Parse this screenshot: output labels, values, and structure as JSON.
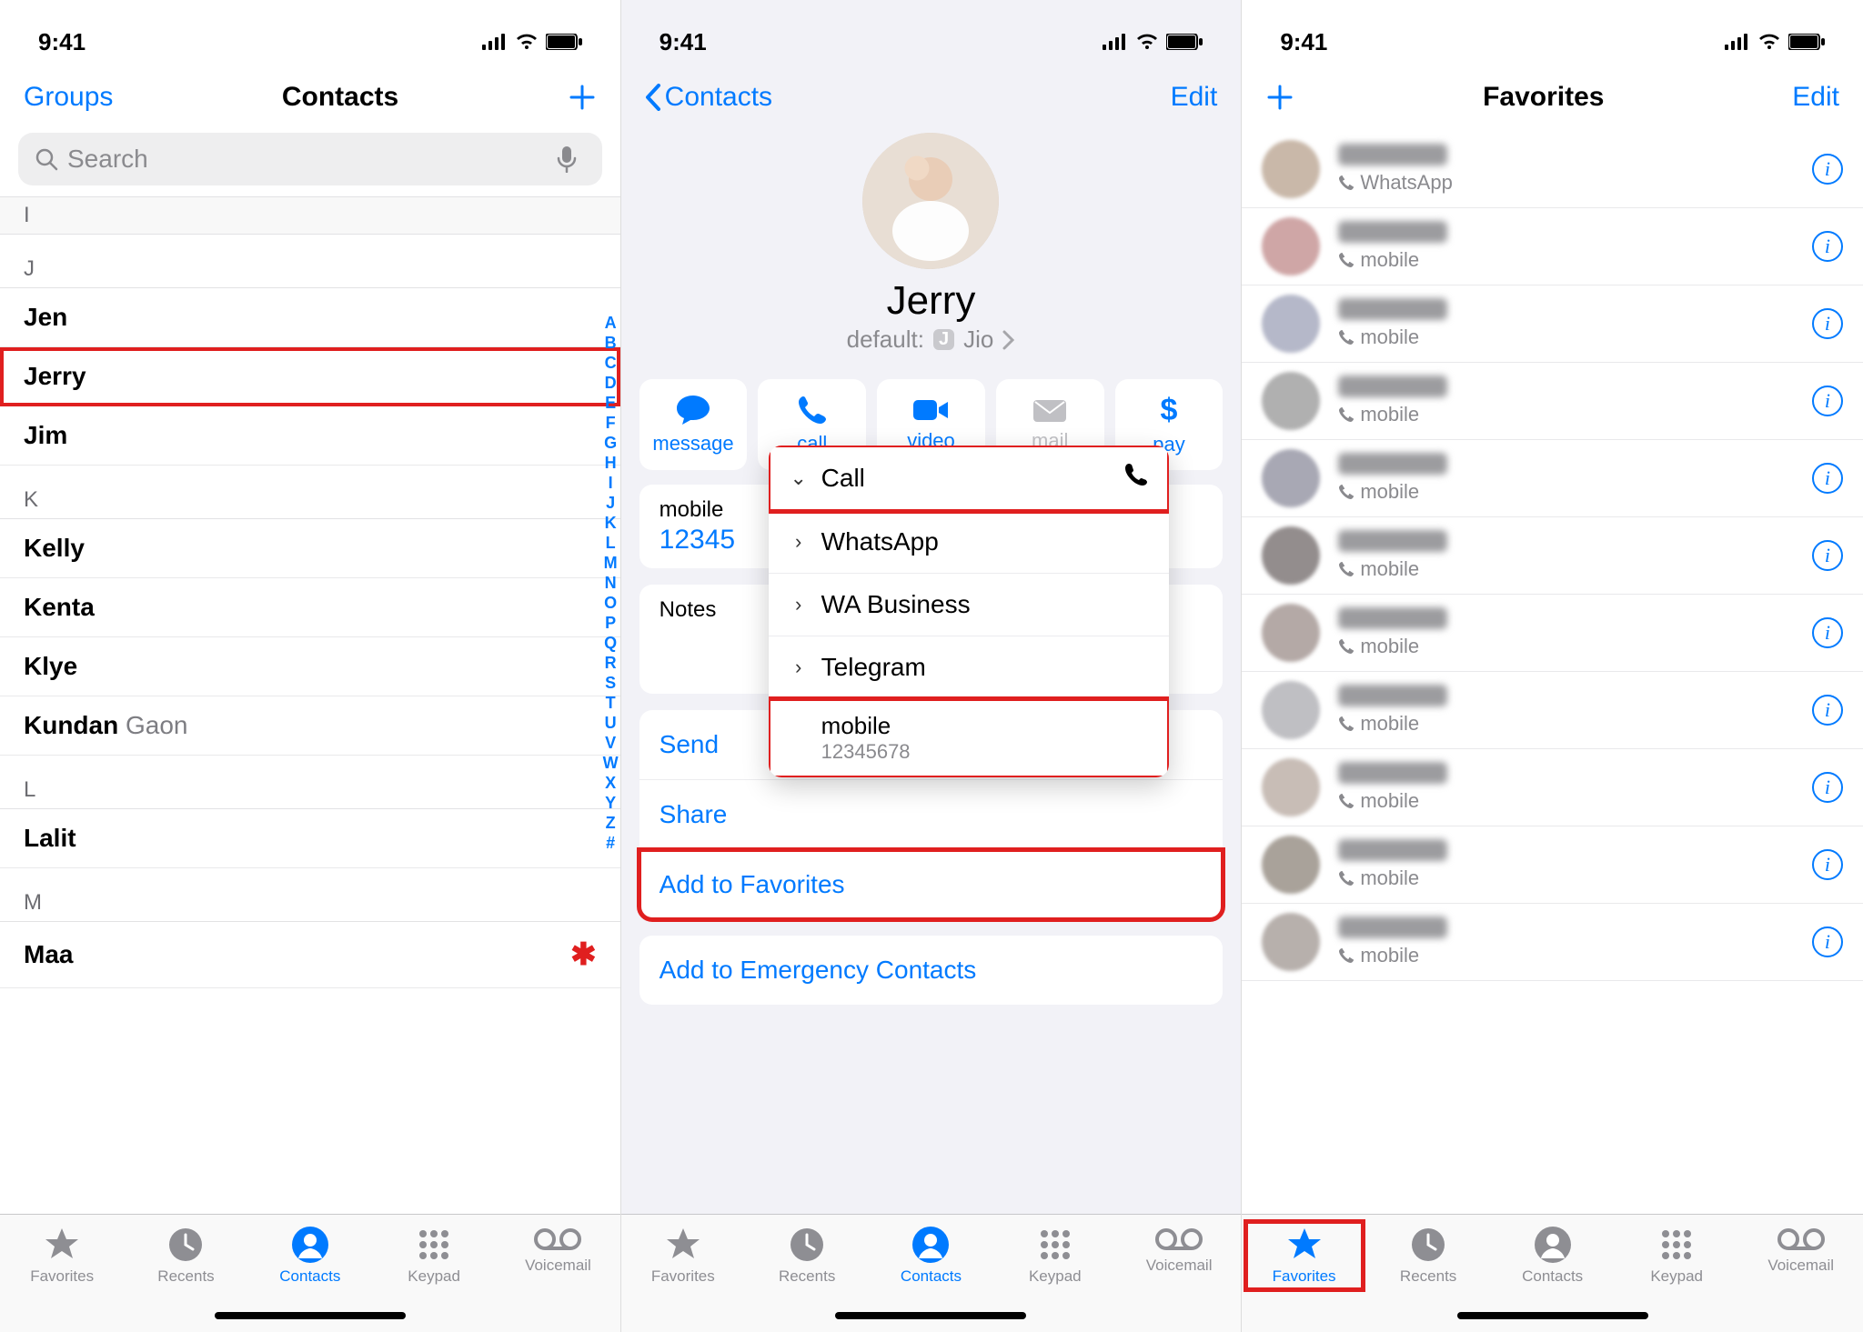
{
  "status": {
    "time": "9:41"
  },
  "screen1": {
    "nav": {
      "left": "Groups",
      "title": "Contacts"
    },
    "search": {
      "placeholder": "Search"
    },
    "sections": {
      "i": "I",
      "j": "J",
      "k": "K",
      "l": "L",
      "m": "M"
    },
    "contacts": {
      "jen": "Jen",
      "jerry": "Jerry",
      "jim": "Jim",
      "kelly": "Kelly",
      "kenta": "Kenta",
      "klye": "Klye",
      "kundan_first": "Kundan",
      "kundan_last": "Gaon",
      "lalit": "Lalit",
      "maa": "Maa"
    },
    "index": [
      "A",
      "B",
      "C",
      "D",
      "E",
      "F",
      "G",
      "H",
      "I",
      "J",
      "K",
      "L",
      "M",
      "N",
      "O",
      "P",
      "Q",
      "R",
      "S",
      "T",
      "U",
      "V",
      "W",
      "X",
      "Y",
      "Z",
      "#"
    ]
  },
  "screen2": {
    "nav": {
      "back": "Contacts",
      "right": "Edit"
    },
    "name": "Jerry",
    "default_label": "default:",
    "default_value": "Jio",
    "actions": {
      "message": "message",
      "call": "call",
      "video": "video",
      "mail": "mail",
      "pay": "pay"
    },
    "mobile": {
      "label": "mobile",
      "value": "12345"
    },
    "notes_label": "Notes",
    "send": "Send",
    "share": "Share",
    "add_fav": "Add to Favorites",
    "add_emg": "Add to Emergency Contacts",
    "popup": {
      "call": "Call",
      "whatsapp": "WhatsApp",
      "wabusiness": "WA Business",
      "telegram": "Telegram",
      "mobile_label": "mobile",
      "mobile_value": "12345678"
    }
  },
  "screen3": {
    "nav": {
      "title": "Favorites",
      "right": "Edit"
    },
    "sub": {
      "whatsapp": "WhatsApp",
      "mobile": "mobile"
    }
  },
  "tabs": {
    "favorites": "Favorites",
    "recents": "Recents",
    "contacts": "Contacts",
    "keypad": "Keypad",
    "voicemail": "Voicemail"
  }
}
